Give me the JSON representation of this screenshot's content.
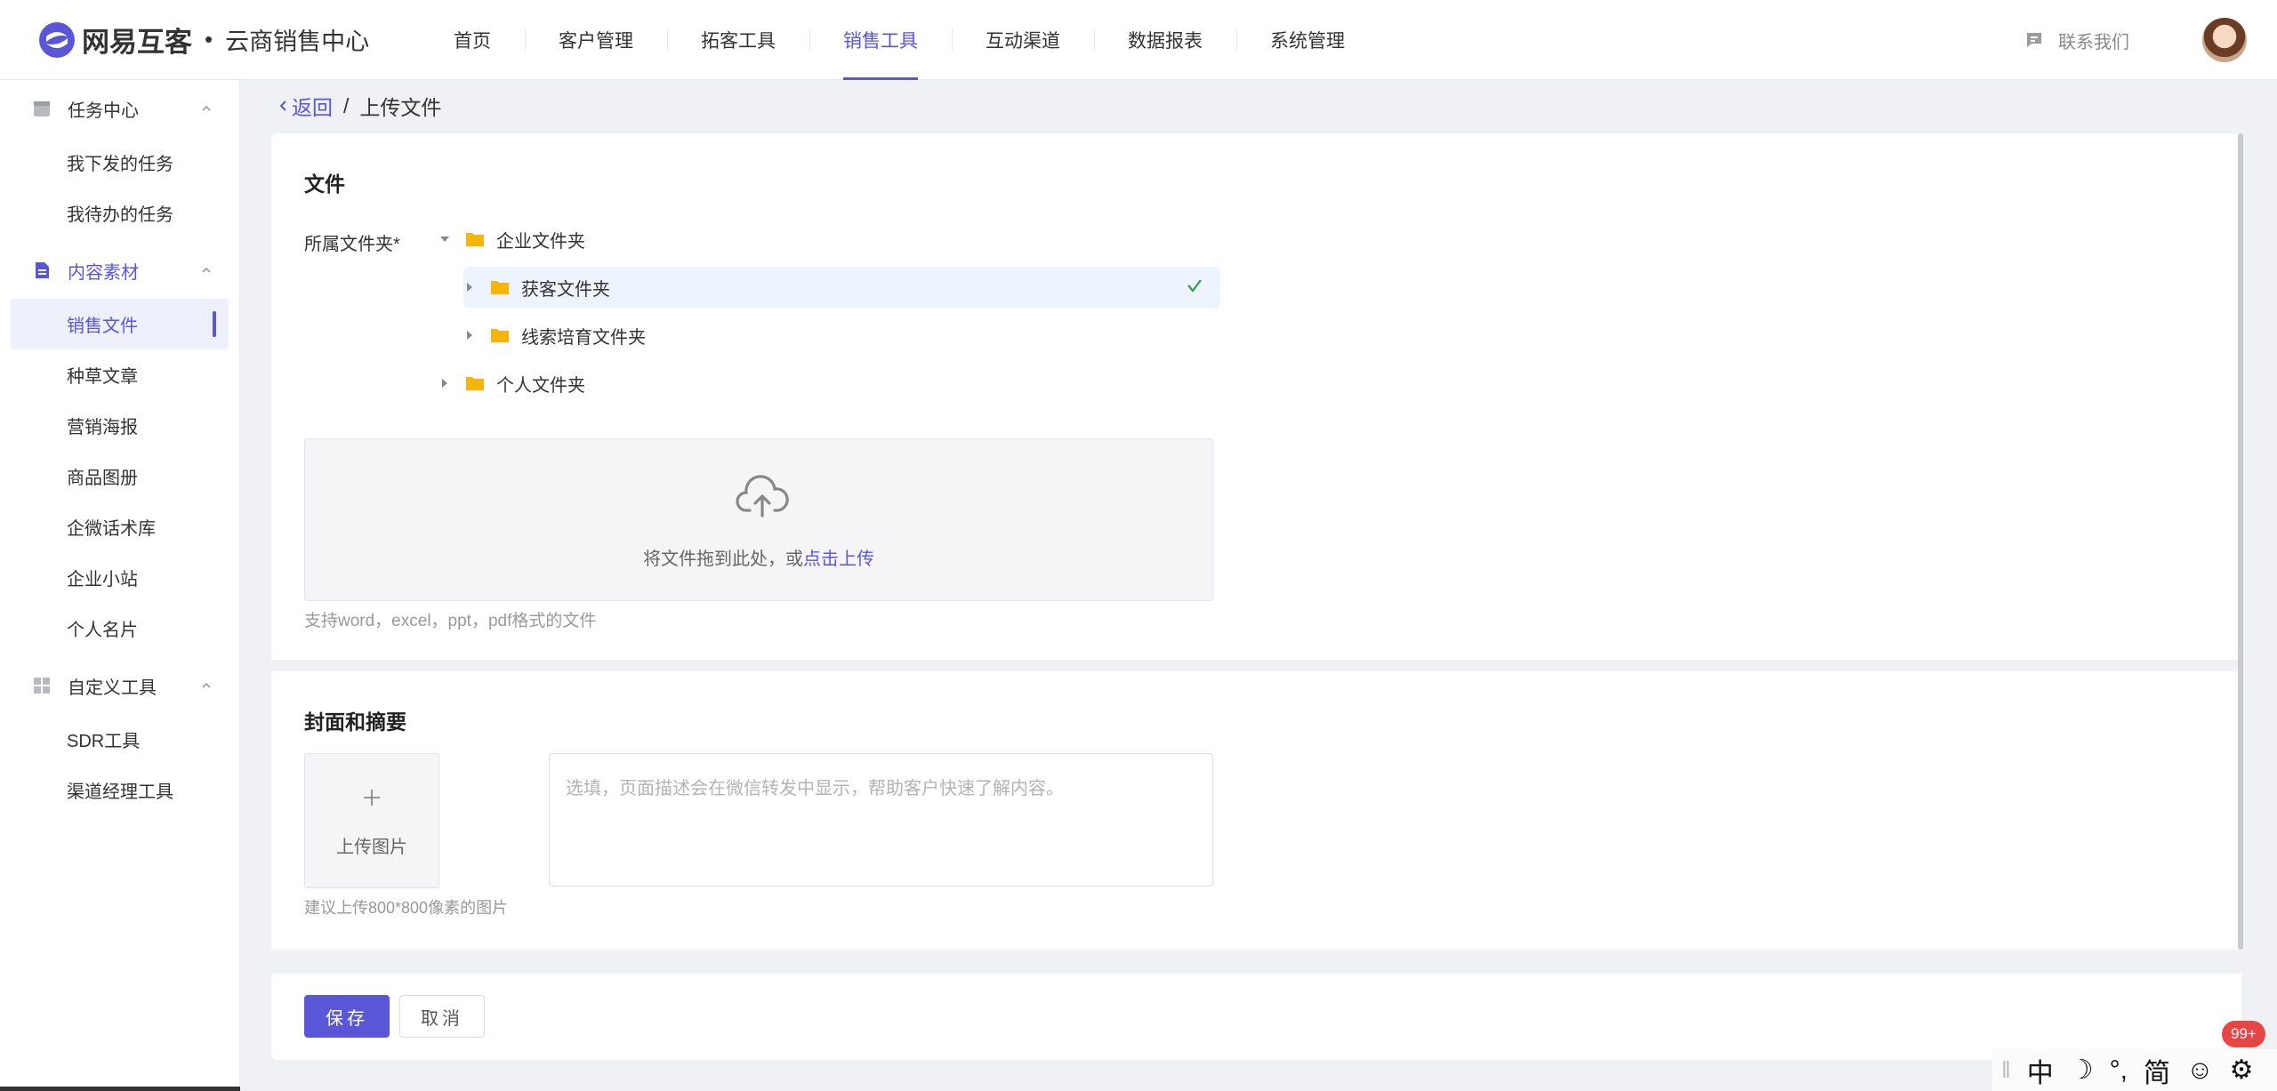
{
  "brand": {
    "name": "网易互客",
    "dot": "•",
    "subtitle": "云商销售中心"
  },
  "nav": {
    "items": [
      {
        "label": "首页"
      },
      {
        "label": "客户管理"
      },
      {
        "label": "拓客工具"
      },
      {
        "label": "销售工具",
        "active": true
      },
      {
        "label": "互动渠道"
      },
      {
        "label": "数据报表"
      },
      {
        "label": "系统管理"
      }
    ],
    "contact_label": "联系我们"
  },
  "sidebar": {
    "groups": [
      {
        "label": "任务中心",
        "icon": "calendar-icon",
        "items": [
          "我下发的任务",
          "我待办的任务"
        ]
      },
      {
        "label": "内容素材",
        "icon": "document-icon",
        "active": true,
        "items": [
          "销售文件",
          "种草文章",
          "营销海报",
          "商品图册",
          "企微话术库",
          "企业小站",
          "个人名片"
        ]
      },
      {
        "label": "自定义工具",
        "icon": "grid-icon",
        "items": [
          "SDR工具",
          "渠道经理工具"
        ]
      }
    ],
    "active_item": "销售文件"
  },
  "breadcrumb": {
    "back": "返回",
    "sep": "/",
    "current": "上传文件"
  },
  "file_section": {
    "title": "文件",
    "folder_label": "所属文件夹*",
    "tree": [
      {
        "label": "企业文件夹",
        "expanded": true
      },
      {
        "label": "获客文件夹",
        "selected": true
      },
      {
        "label": "线索培育文件夹"
      },
      {
        "label": "个人文件夹"
      }
    ],
    "dropzone_text": "将文件拖到此处，或",
    "dropzone_link": "点击上传",
    "hint": "支持word，excel，ppt，pdf格式的文件"
  },
  "cover_section": {
    "title": "封面和摘要",
    "upload_label": "上传图片",
    "upload_hint": "建议上传800*800像素的图片",
    "desc_placeholder": "选填，页面描述会在微信转发中显示，帮助客户快速了解内容。",
    "desc_value": ""
  },
  "actions": {
    "save": "保存",
    "cancel": "取消"
  },
  "ime": {
    "mode": "中",
    "moon": "☽",
    "punct": "°,",
    "script": "简",
    "emoji": "☺",
    "gear": "⚙"
  },
  "badge": "99+",
  "colors": {
    "accent": "#5a56d8",
    "folder": "#f5b50a",
    "check": "#2e9e4f",
    "badge": "#e84545"
  }
}
